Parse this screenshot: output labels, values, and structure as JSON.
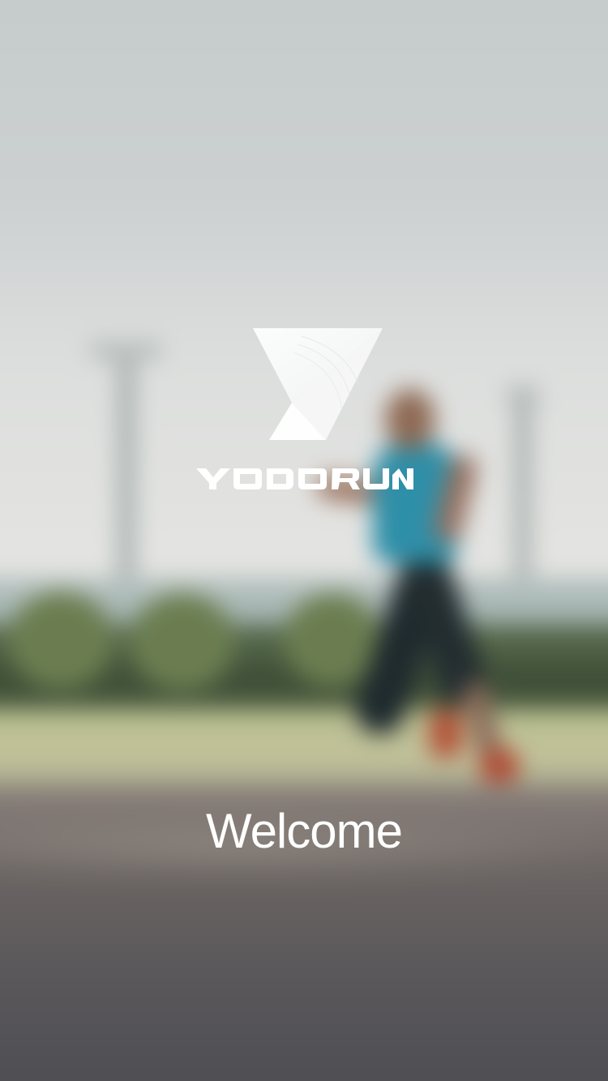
{
  "brand": {
    "name": "YODO RUN",
    "logo_icon": "yodo-run-triangle-logo-icon"
  },
  "welcome": {
    "text": "Welcome"
  },
  "background": {
    "description_icon": "blurred-runner-photo",
    "colors": {
      "sky": "#c9cece",
      "shirt": "#2e8fa8",
      "track": "#59575a",
      "grass": "#b7bd8e"
    }
  },
  "colors": {
    "foreground_text": "#ffffff"
  }
}
